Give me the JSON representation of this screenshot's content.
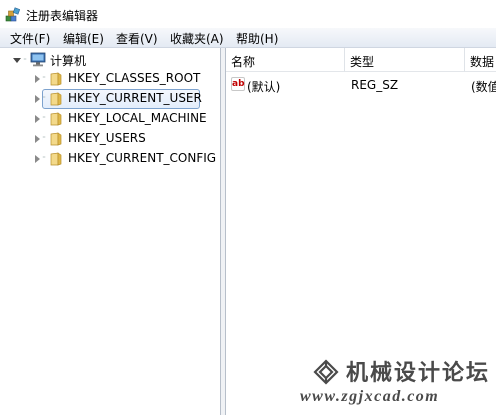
{
  "window": {
    "title": "注册表编辑器",
    "icon": "registry-editor-icon"
  },
  "menubar": {
    "items": [
      "文件(F)",
      "编辑(E)",
      "查看(V)",
      "收藏夹(A)",
      "帮助(H)"
    ]
  },
  "tree": {
    "root": {
      "label": "计算机",
      "icon": "computer-icon",
      "expanded": true
    },
    "nodes": [
      {
        "label": "HKEY_CLASSES_ROOT",
        "selected": false
      },
      {
        "label": "HKEY_CURRENT_USER",
        "selected": true
      },
      {
        "label": "HKEY_LOCAL_MACHINE",
        "selected": false
      },
      {
        "label": "HKEY_USERS",
        "selected": false
      },
      {
        "label": "HKEY_CURRENT_CONFIG",
        "selected": false
      }
    ]
  },
  "list": {
    "columns": [
      "名称",
      "类型",
      "数据"
    ],
    "rows": [
      {
        "name": "(默认)",
        "type": "REG_SZ",
        "data": "(数值",
        "icon": "string-value-icon"
      }
    ]
  },
  "watermark": {
    "title": "机械设计论坛",
    "url": "www.zgjxcad.com"
  },
  "colors": {
    "selection_border": "#7da2ce",
    "folder": "#e8c35a",
    "menubar": "#e4eaf3"
  }
}
